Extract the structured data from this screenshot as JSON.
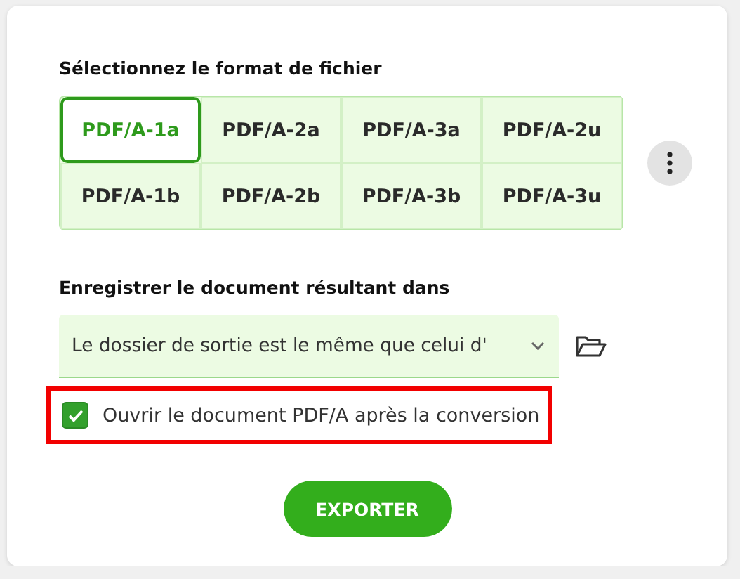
{
  "format_section": {
    "title": "Sélectionnez le format de fichier",
    "formats": [
      {
        "label": "PDF/A-1a",
        "selected": true
      },
      {
        "label": "PDF/A-2a",
        "selected": false
      },
      {
        "label": "PDF/A-3a",
        "selected": false
      },
      {
        "label": "PDF/A-2u",
        "selected": false
      },
      {
        "label": "PDF/A-1b",
        "selected": false
      },
      {
        "label": "PDF/A-2b",
        "selected": false
      },
      {
        "label": "PDF/A-3b",
        "selected": false
      },
      {
        "label": "PDF/A-3u",
        "selected": false
      }
    ]
  },
  "save_section": {
    "title": "Enregistrer le document résultant dans",
    "folder_value": "Le dossier de sortie est le même que celui d'"
  },
  "open_after": {
    "label": "Ouvrir le document PDF/A après la conversion",
    "checked": true,
    "highlighted": true
  },
  "export_button": "EXPORTER"
}
